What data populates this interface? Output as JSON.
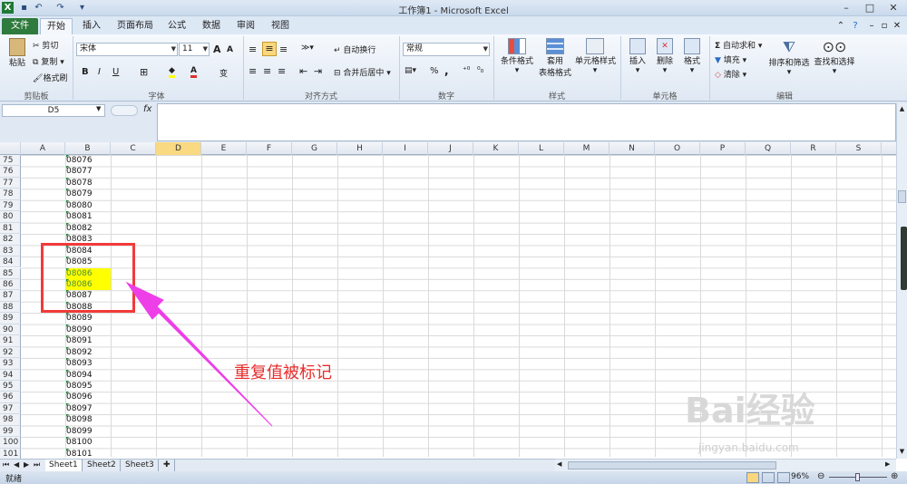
{
  "window": {
    "title": "工作簿1 - Microsoft Excel"
  },
  "tabs": [
    "文件",
    "开始",
    "插入",
    "页面布局",
    "公式",
    "数据",
    "审阅",
    "视图"
  ],
  "ribbon": {
    "clipboard": {
      "paste": "粘贴",
      "cut": "剪切",
      "copy": "复制",
      "format_painter": "格式刷",
      "label": "剪贴板"
    },
    "font": {
      "name": "宋体",
      "size": "11",
      "label": "字体",
      "bold": "B",
      "italic": "I",
      "underline": "U",
      "grow": "A",
      "shrink": "A",
      "phonetic": "变"
    },
    "alignment": {
      "wrap": "自动换行",
      "merge": "合并后居中",
      "label": "对齐方式"
    },
    "number": {
      "format": "常规",
      "percent": "%",
      "comma": ",",
      "label": "数字"
    },
    "styles": {
      "conditional": "条件格式",
      "table": "套用",
      "table2": "表格格式",
      "cell_styles": "单元格样式",
      "label": "样式"
    },
    "cells": {
      "insert": "插入",
      "delete": "删除",
      "format": "格式",
      "label": "单元格"
    },
    "editing": {
      "autosum": "自动求和",
      "fill": "填充",
      "clear": "清除",
      "sort": "排序和筛选",
      "find": "查找和选择",
      "label": "编辑",
      "sigma": "Σ"
    }
  },
  "formula_bar": {
    "name_box": "D5",
    "fx": "fx",
    "content": ""
  },
  "columns": [
    "A",
    "B",
    "C",
    "D",
    "E",
    "F",
    "G",
    "H",
    "I",
    "J",
    "K",
    "L",
    "M",
    "N",
    "O",
    "P",
    "Q",
    "R",
    "S"
  ],
  "selected_column": "D",
  "rows": [
    {
      "n": "75",
      "b": "08076"
    },
    {
      "n": "76",
      "b": "08077"
    },
    {
      "n": "77",
      "b": "08078"
    },
    {
      "n": "78",
      "b": "08079"
    },
    {
      "n": "79",
      "b": "08080"
    },
    {
      "n": "80",
      "b": "08081"
    },
    {
      "n": "81",
      "b": "08082"
    },
    {
      "n": "82",
      "b": "08083"
    },
    {
      "n": "83",
      "b": "08084"
    },
    {
      "n": "84",
      "b": "08085"
    },
    {
      "n": "85",
      "b": "08086",
      "dup": true
    },
    {
      "n": "86",
      "b": "08086",
      "dup": true
    },
    {
      "n": "87",
      "b": "08087"
    },
    {
      "n": "88",
      "b": "08088"
    },
    {
      "n": "89",
      "b": "08089"
    },
    {
      "n": "90",
      "b": "08090"
    },
    {
      "n": "91",
      "b": "08091"
    },
    {
      "n": "92",
      "b": "08092"
    },
    {
      "n": "93",
      "b": "08093"
    },
    {
      "n": "94",
      "b": "08094"
    },
    {
      "n": "95",
      "b": "08095"
    },
    {
      "n": "96",
      "b": "08096"
    },
    {
      "n": "97",
      "b": "08097"
    },
    {
      "n": "98",
      "b": "08098"
    },
    {
      "n": "99",
      "b": "08099"
    },
    {
      "n": "100",
      "b": "08100"
    },
    {
      "n": "101",
      "b": "08101"
    }
  ],
  "sheets": [
    "Sheet1",
    "Sheet2",
    "Sheet3"
  ],
  "status": {
    "ready": "就绪",
    "zoom": "96%"
  },
  "annotation": "重复值被标记",
  "watermark": {
    "brand": "Bai经验",
    "url": "jingyan.baidu.com"
  },
  "colors": {
    "duplicate_fill": "#ffff00",
    "annotation_red": "#f23a3a",
    "arrow_magenta": "#ee3ee8",
    "excel_green": "#2f7a3d"
  }
}
